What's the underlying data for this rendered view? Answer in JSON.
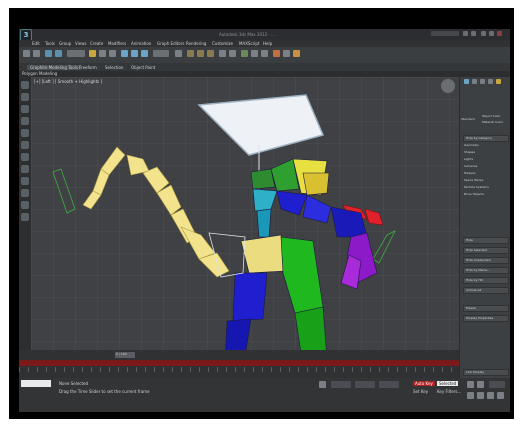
{
  "window": {
    "title": "Autodesk 3ds Max 2012 - ...",
    "logo": "3"
  },
  "menu": [
    "Edit",
    "Tools",
    "Group",
    "Views",
    "Create",
    "Modifiers",
    "Animation",
    "Graph Editors",
    "Rendering",
    "Customize",
    "MAXScript",
    "Help"
  ],
  "ribbon": {
    "tabs": [
      "Graphite Modeling Tools",
      "Freeform",
      "Selection",
      "Object Paint"
    ],
    "active_label": "Polygon Modeling"
  },
  "viewport": {
    "label": "[+] [Left ] [ Smooth + Highlights ]"
  },
  "right_panel": {
    "header": [
      "Standard",
      "Object Color",
      "Material Color"
    ],
    "rollouts": [
      "Hide by Category",
      "Geometry",
      "Shapes",
      "Lights",
      "Cameras",
      "Helpers",
      "Space Warps",
      "Particle Systems",
      "Bone Objects",
      "Hide",
      "Hide Selected",
      "Hide Unselected",
      "Hide by Name...",
      "Hide by Hit",
      "Unhide All",
      "Freeze",
      "Display Properties",
      "Link Display"
    ]
  },
  "timeline": {
    "frame_readout": "0 / 100"
  },
  "status": {
    "selection": "None Selected",
    "prompt": "Drag the Time Slider to set the current frame",
    "autokey": "Auto Key",
    "selected": "Selected",
    "setkey": "Set Key",
    "filters": "Key Filters..."
  },
  "colors": {
    "frame": "#000000",
    "bg": "#3a3c3e",
    "viewport": "#3f4144",
    "timeline_red": "#7a1a1a"
  }
}
